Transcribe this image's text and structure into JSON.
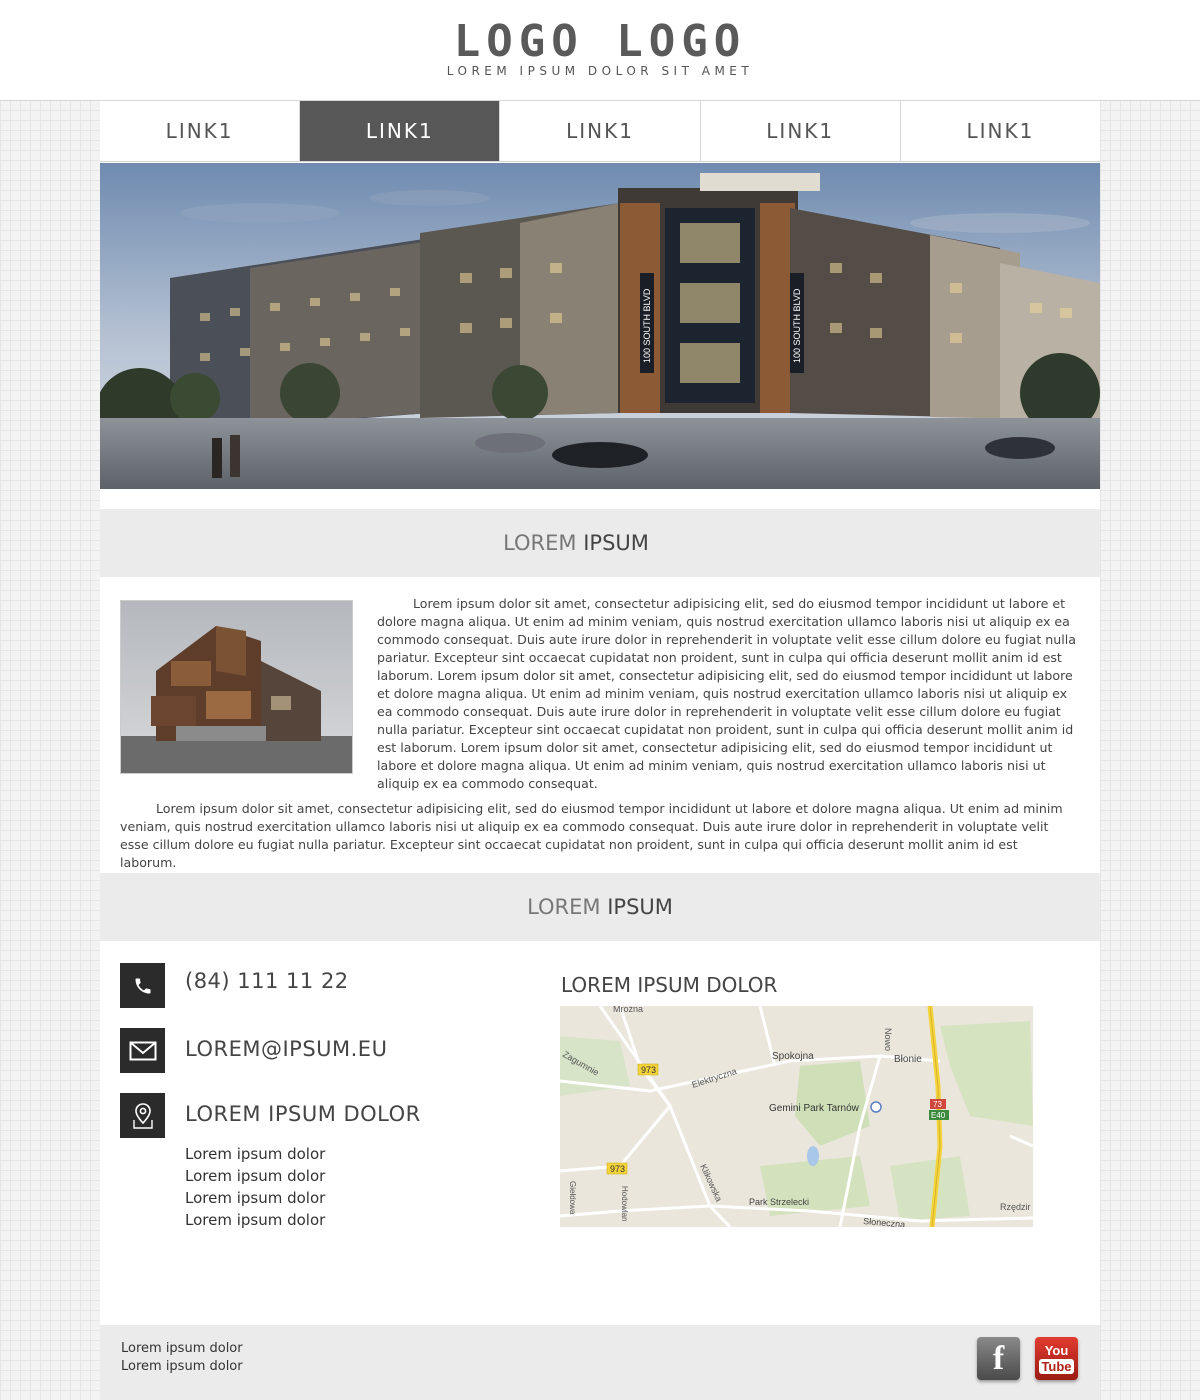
{
  "header": {
    "logo": "LOGO LOGO",
    "tagline": "LOREM IPSUM DOLOR SIT AMET"
  },
  "nav": {
    "items": [
      "LINK1",
      "LINK1",
      "LINK1",
      "LINK1",
      "LINK1"
    ],
    "active_index": 1
  },
  "hero": {
    "signs": [
      "100 SOUTH BLVD",
      "100 SOUTH BLVD"
    ]
  },
  "section1": {
    "title_light": "LOREM",
    "title_bold": "IPSUM",
    "para1": "Lorem ipsum dolor sit amet, consectetur adipisicing elit, sed do eiusmod tempor incididunt ut labore et dolore magna aliqua. Ut enim ad minim veniam, quis nostrud exercitation ullamco laboris nisi ut aliquip ex ea commodo consequat. Duis aute irure dolor in reprehenderit in voluptate velit esse cillum dolore eu fugiat nulla pariatur. Excepteur sint occaecat cupidatat non proident, sunt in culpa qui officia deserunt mollit anim id est laborum. Lorem ipsum dolor sit amet, consectetur adipisicing elit, sed do eiusmod tempor incididunt ut labore et dolore magna aliqua. Ut enim ad minim veniam, quis nostrud exercitation ullamco laboris nisi ut aliquip ex ea commodo consequat. Duis aute irure dolor in reprehenderit in voluptate velit esse cillum dolore eu fugiat nulla pariatur. Excepteur sint occaecat cupidatat non proident, sunt in culpa qui officia deserunt mollit anim id est laborum. Lorem ipsum dolor sit amet, consectetur adipisicing elit, sed do eiusmod tempor incididunt ut labore et dolore magna aliqua. Ut enim ad minim veniam, quis nostrud exercitation ullamco laboris nisi ut aliquip ex ea commodo consequat.",
    "para2": "Lorem ipsum dolor sit amet, consectetur adipisicing elit, sed do eiusmod tempor incididunt ut labore et dolore magna aliqua. Ut enim ad minim veniam, quis nostrud exercitation ullamco laboris nisi ut aliquip ex ea commodo consequat. Duis aute irure dolor in reprehenderit in voluptate velit esse cillum dolore eu fugiat nulla pariatur. Excepteur sint occaecat cupidatat non proident, sunt in culpa qui officia deserunt mollit anim id est laborum."
  },
  "section2": {
    "title_light": "LOREM",
    "title_bold": "IPSUM",
    "phone": "(84) 111 11 22",
    "email": "LOREM@IPSUM.EU",
    "address_title": "LOREM IPSUM DOLOR",
    "address_lines": [
      "Lorem ipsum dolor",
      "Lorem ipsum dolor",
      "Lorem ipsum dolor",
      "Lorem ipsum dolor"
    ],
    "map_title": "LOREM IPSUM DOLOR",
    "map_labels": {
      "mrozna": "Mroźna",
      "zagumnie": "Zagumnie",
      "r973a": "973",
      "r973b": "973",
      "elektryczna": "Elektryczna",
      "spokojna": "Spokojna",
      "blonie": "Błonie",
      "nowo": "Nowo",
      "gemini": "Gemini Park Tarnów",
      "r73": "73",
      "e40": "E40",
      "klikowska": "Klikowska",
      "gieldowa": "Giełdowa",
      "hodowlana": "Hodowlan",
      "park": "Park Strzelecki",
      "sloneczna": "Słoneczna",
      "rzedzin": "Rzędzir"
    }
  },
  "footer": {
    "lines": [
      "Lorem ipsum dolor",
      "Lorem ipsum dolor"
    ],
    "youtube_top": "You",
    "youtube_bottom": "Tube",
    "facebook": "f"
  },
  "colors": {
    "nav_active": "#575757",
    "section_head_bg": "#ebebeb",
    "icon_box": "#2b2b2b",
    "youtube_red": "#c4281c",
    "highway_yellow": "#f5d33a"
  }
}
